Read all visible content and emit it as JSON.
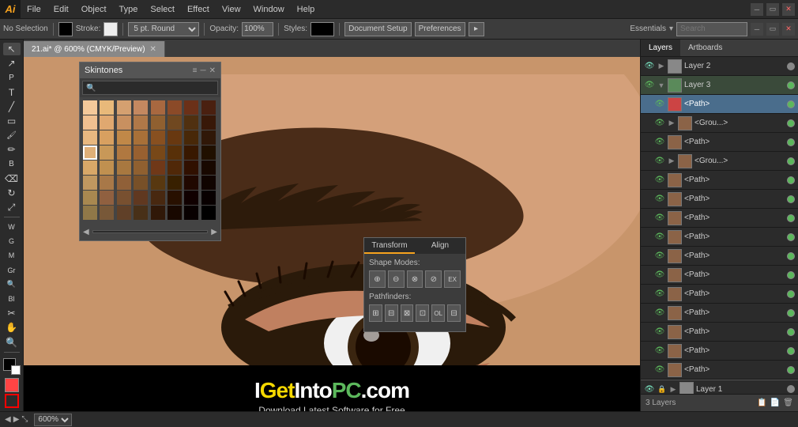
{
  "app": {
    "logo": "Ai",
    "title": "Adobe Illustrator"
  },
  "menu": {
    "items": [
      "File",
      "Edit",
      "Object",
      "Type",
      "Select",
      "Effect",
      "View",
      "Window",
      "Help"
    ]
  },
  "toolbar": {
    "selection": "No Selection",
    "stroke_label": "Stroke:",
    "stroke_value": "",
    "brush_label": "5 pt. Round",
    "opacity_label": "Opacity:",
    "opacity_value": "100%",
    "styles_label": "Styles:",
    "setup_btn": "Document Setup",
    "prefs_btn": "Preferences",
    "essentials_label": "Essentials",
    "search_placeholder": "Search"
  },
  "document": {
    "tab_label": "21.ai* @ 600% (CMYK/Preview)",
    "zoom": "600%"
  },
  "skintones_panel": {
    "title": "Skintones",
    "search_placeholder": "🔍",
    "swatches": [
      "#f4c99a",
      "#e8b97a",
      "#d4a070",
      "#c48860",
      "#a86840",
      "#8b4a28",
      "#6b3018",
      "#4a2010",
      "#f0c090",
      "#e0a870",
      "#c89060",
      "#b07848",
      "#906030",
      "#704820",
      "#503010",
      "#381808",
      "#e8b880",
      "#d8a060",
      "#c08848",
      "#a87038",
      "#885020",
      "#683810",
      "#482808",
      "#301808",
      "#e0b078",
      "#c89858",
      "#b07840",
      "#986030",
      "#784818",
      "#583008",
      "#381800",
      "#201000",
      "#d8a868",
      "#c09050",
      "#a87840",
      "#906030",
      "#703818",
      "#502808",
      "#301000",
      "#180800",
      "#c09860",
      "#a87848",
      "#906038",
      "#785028",
      "#583810",
      "#382000",
      "#200800",
      "#100400",
      "#a88850",
      "#906040",
      "#785030",
      "#603820",
      "#482810",
      "#281000",
      "#100000",
      "#080000",
      "#907848",
      "#785838",
      "#604028",
      "#483018",
      "#301808",
      "#180800",
      "#080000",
      "#000000"
    ],
    "nav_prev": "◀",
    "nav_next": "▶",
    "menu_btn": "≡",
    "close_btn": "✕"
  },
  "transform_popup": {
    "tab1": "Transform",
    "tab2": "Align",
    "shape_modes_label": "Shape Modes:",
    "pathfinders_label": "Pathfinders:"
  },
  "layers_panel": {
    "tabs": [
      "Layers",
      "Artboards"
    ],
    "active_tab": "Layers",
    "layers": [
      {
        "id": "layer2",
        "name": "Layer 2",
        "type": "layer",
        "visible": true,
        "locked": false,
        "expanded": false,
        "indent": 0,
        "color": "#888"
      },
      {
        "id": "layer3",
        "name": "Layer 3",
        "type": "layer",
        "visible": true,
        "locked": false,
        "expanded": true,
        "indent": 0,
        "color": "#5cb85c"
      },
      {
        "id": "path1",
        "name": "<Path>",
        "type": "path",
        "visible": true,
        "locked": false,
        "indent": 1,
        "selected": true,
        "thumb_color": "#cc4444"
      },
      {
        "id": "group1",
        "name": "<Grou...>",
        "type": "group",
        "visible": true,
        "locked": false,
        "indent": 1,
        "thumb_color": "#8b6347"
      },
      {
        "id": "path2",
        "name": "<Path>",
        "type": "path",
        "visible": true,
        "locked": false,
        "indent": 1,
        "thumb_color": "#8b6347"
      },
      {
        "id": "group2",
        "name": "<Grou...>",
        "type": "group",
        "visible": true,
        "locked": false,
        "indent": 1,
        "thumb_color": "#8b6347"
      },
      {
        "id": "path3",
        "name": "<Path>",
        "type": "path",
        "visible": true,
        "locked": false,
        "indent": 1,
        "thumb_color": "#8b6347"
      },
      {
        "id": "path4",
        "name": "<Path>",
        "type": "path",
        "visible": true,
        "locked": false,
        "indent": 1,
        "thumb_color": "#8b6347"
      },
      {
        "id": "path5",
        "name": "<Path>",
        "type": "path",
        "visible": true,
        "locked": false,
        "indent": 1,
        "thumb_color": "#8b6347"
      },
      {
        "id": "path6",
        "name": "<Path>",
        "type": "path",
        "visible": true,
        "locked": false,
        "indent": 1,
        "thumb_color": "#8b6347"
      },
      {
        "id": "path7",
        "name": "<Path>",
        "type": "path",
        "visible": true,
        "locked": false,
        "indent": 1,
        "thumb_color": "#8b6347"
      },
      {
        "id": "path8",
        "name": "<Path>",
        "type": "path",
        "visible": true,
        "locked": false,
        "indent": 1,
        "thumb_color": "#8b6347"
      },
      {
        "id": "path9",
        "name": "<Path>",
        "type": "path",
        "visible": true,
        "locked": false,
        "indent": 1,
        "thumb_color": "#8b6347"
      },
      {
        "id": "path10",
        "name": "<Path>",
        "type": "path",
        "visible": true,
        "locked": false,
        "indent": 1,
        "thumb_color": "#8b6347"
      },
      {
        "id": "path11",
        "name": "<Path>",
        "type": "path",
        "visible": true,
        "locked": false,
        "indent": 1,
        "thumb_color": "#8b6347"
      },
      {
        "id": "path12",
        "name": "<Path>",
        "type": "path",
        "visible": true,
        "locked": false,
        "indent": 1,
        "thumb_color": "#8b6347"
      },
      {
        "id": "path13",
        "name": "<Path>",
        "type": "path",
        "visible": true,
        "locked": false,
        "indent": 1,
        "thumb_color": "#8b6347"
      },
      {
        "id": "layer1",
        "name": "Layer 1",
        "type": "layer",
        "visible": true,
        "locked": true,
        "expanded": false,
        "indent": 0,
        "color": "#888"
      }
    ],
    "bottom_label": "3 Layers",
    "icons": {
      "new_layer": "📄",
      "delete_layer": "🗑",
      "new_sublayer": "📋"
    }
  },
  "status_bar": {
    "zoom": "600%",
    "info": ""
  },
  "watermark": {
    "logo_prefix": "I",
    "logo_get": "Get",
    "logo_into": "Into",
    "logo_pc": "PC",
    "logo_domain": ".com",
    "subtitle": "Download Latest Software for Free"
  },
  "tools": {
    "left": [
      "↖",
      "✎",
      "✏",
      "P",
      "T",
      "▭",
      "◯",
      "✂",
      "🖌",
      "⊗",
      "🔍",
      "🖐"
    ],
    "colors": {
      "fg": "#000000",
      "bg": "#ffffff"
    }
  }
}
